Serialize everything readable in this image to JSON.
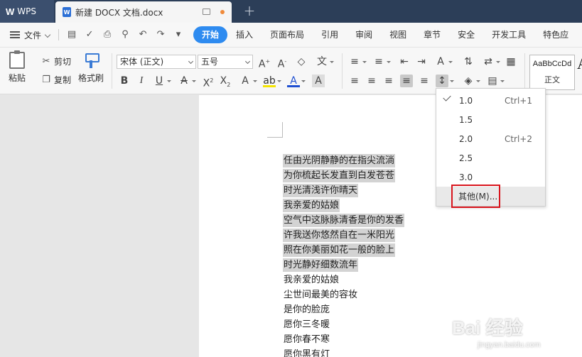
{
  "titlebar": {
    "app_name": "WPS",
    "doc_title": "新建 DOCX 文档.docx",
    "new_tab_symbol": "+",
    "unsaved_dot_color": "#f08a3a"
  },
  "menubar": {
    "file_label": "文件",
    "qa_icons": [
      "save-icon",
      "format-painter-icon",
      "print-icon",
      "print-preview-icon",
      "undo-icon",
      "redo-icon",
      "more-icon"
    ],
    "tabs": [
      {
        "label": "开始",
        "active": true
      },
      {
        "label": "插入"
      },
      {
        "label": "页面布局"
      },
      {
        "label": "引用"
      },
      {
        "label": "审阅"
      },
      {
        "label": "视图"
      },
      {
        "label": "章节"
      },
      {
        "label": "安全"
      },
      {
        "label": "开发工具"
      },
      {
        "label": "特色应"
      }
    ],
    "accent_color": "#2e8bf0"
  },
  "ribbon": {
    "paste_label": "粘贴",
    "cut_label": "剪切",
    "copy_label": "复制",
    "format_brush_label": "格式刷",
    "font_name": "宋体 (正文)",
    "font_size": "五号",
    "style_sample": "AaBbCcDd",
    "style_name": "正文"
  },
  "document": {
    "lines": [
      {
        "text": "任由光阴静静的在指尖流淌",
        "selected": true
      },
      {
        "text": "为你梳起长发直到白发苍苍",
        "selected": true
      },
      {
        "text": "时光清浅许你晴天",
        "selected": true
      },
      {
        "text": "我亲爱的姑娘",
        "selected": true
      },
      {
        "text": "空气中这脉脉清香是你的发香",
        "selected": true
      },
      {
        "text": "许我送你悠然自在一米阳光",
        "selected": true
      },
      {
        "text": "照在你美丽如花一般的脸上",
        "selected": true
      },
      {
        "text": "时光静好细数流年",
        "selected": true
      },
      {
        "text": "我亲爱的姑娘",
        "selected": false
      },
      {
        "text": "尘世间最美的容妆",
        "selected": false
      },
      {
        "text": "是你的脸庞",
        "selected": false
      },
      {
        "text": "愿你三冬暖",
        "selected": false
      },
      {
        "text": "愿你春不寒",
        "selected": false
      },
      {
        "text": "愿你黑有灯",
        "selected": false
      }
    ]
  },
  "line_spacing_menu": {
    "items": [
      {
        "value": "1.0",
        "shortcut": "Ctrl+1",
        "checked": true
      },
      {
        "value": "1.5",
        "shortcut": ""
      },
      {
        "value": "2.0",
        "shortcut": "Ctrl+2"
      },
      {
        "value": "2.5",
        "shortcut": ""
      },
      {
        "value": "3.0",
        "shortcut": ""
      }
    ],
    "other_label": "其他(M)...",
    "highlight_color": "#d9151d"
  },
  "watermark": {
    "main": "Bai 经验",
    "sub": "jingyan.baidu.com"
  }
}
